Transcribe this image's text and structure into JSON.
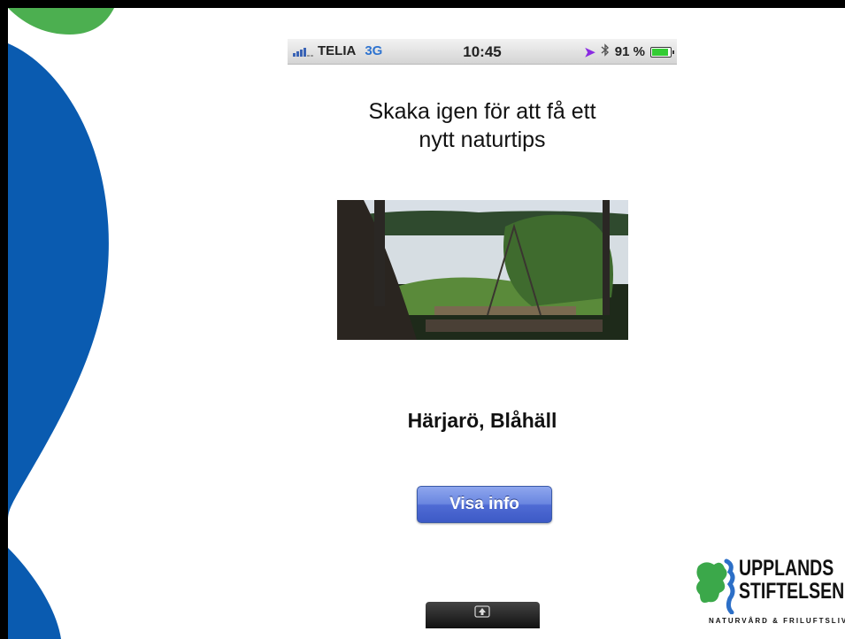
{
  "status_bar": {
    "carrier": "TELIA",
    "network": "3G",
    "time": "10:45",
    "battery": "91 %",
    "battery_level": 0.91,
    "icons": [
      "signal-icon",
      "location-arrow-icon",
      "bluetooth-icon",
      "battery-icon"
    ]
  },
  "main": {
    "instruction_line1": "Skaka igen för att få ett",
    "instruction_line2": "nytt naturtips",
    "place_name": "Härjarö, Blåhäll",
    "info_button": "Visa info"
  },
  "logo": {
    "line1": "UPPLANDS",
    "line2": "STIFTELSEN",
    "tagline": "NATURVÅRD & FRILUFTSLIV"
  },
  "colors": {
    "deco_blue": "#0a5bb0",
    "deco_green": "#4caf50",
    "logo_green": "#3ba84a",
    "logo_blue": "#2c6fc7",
    "button_blue": "#4f6bd4"
  }
}
